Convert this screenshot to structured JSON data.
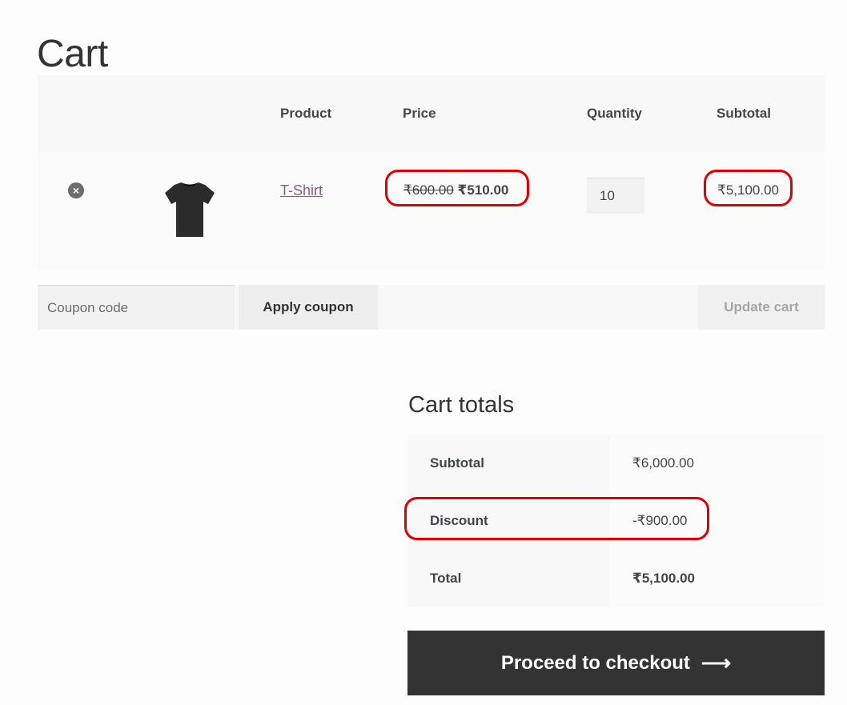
{
  "page": {
    "title": "Cart"
  },
  "cart_table": {
    "headers": {
      "product": "Product",
      "price": "Price",
      "quantity": "Quantity",
      "subtotal": "Subtotal"
    },
    "items": [
      {
        "remove_icon": "remove-circle-icon",
        "thumbnail": "black-tshirt-image",
        "product": "T-Shirt",
        "price_regular": "₹600.00",
        "price_sale": "₹510.00",
        "quantity": "10",
        "subtotal": "₹5,100.00"
      }
    ]
  },
  "actions": {
    "coupon_placeholder": "Coupon code",
    "apply_coupon": "Apply coupon",
    "update_cart": "Update cart"
  },
  "cart_totals": {
    "title": "Cart totals",
    "rows": [
      {
        "label": "Subtotal",
        "value": "₹6,000.00"
      },
      {
        "label": "Discount",
        "value": "-₹900.00"
      },
      {
        "label": "Total",
        "value": "₹5,100.00"
      }
    ]
  },
  "checkout": {
    "label": "Proceed to checkout",
    "icon": "arrow-right-icon"
  },
  "colors": {
    "highlight": "#e00000",
    "link": "#96588a",
    "checkout_bg": "#333333"
  }
}
